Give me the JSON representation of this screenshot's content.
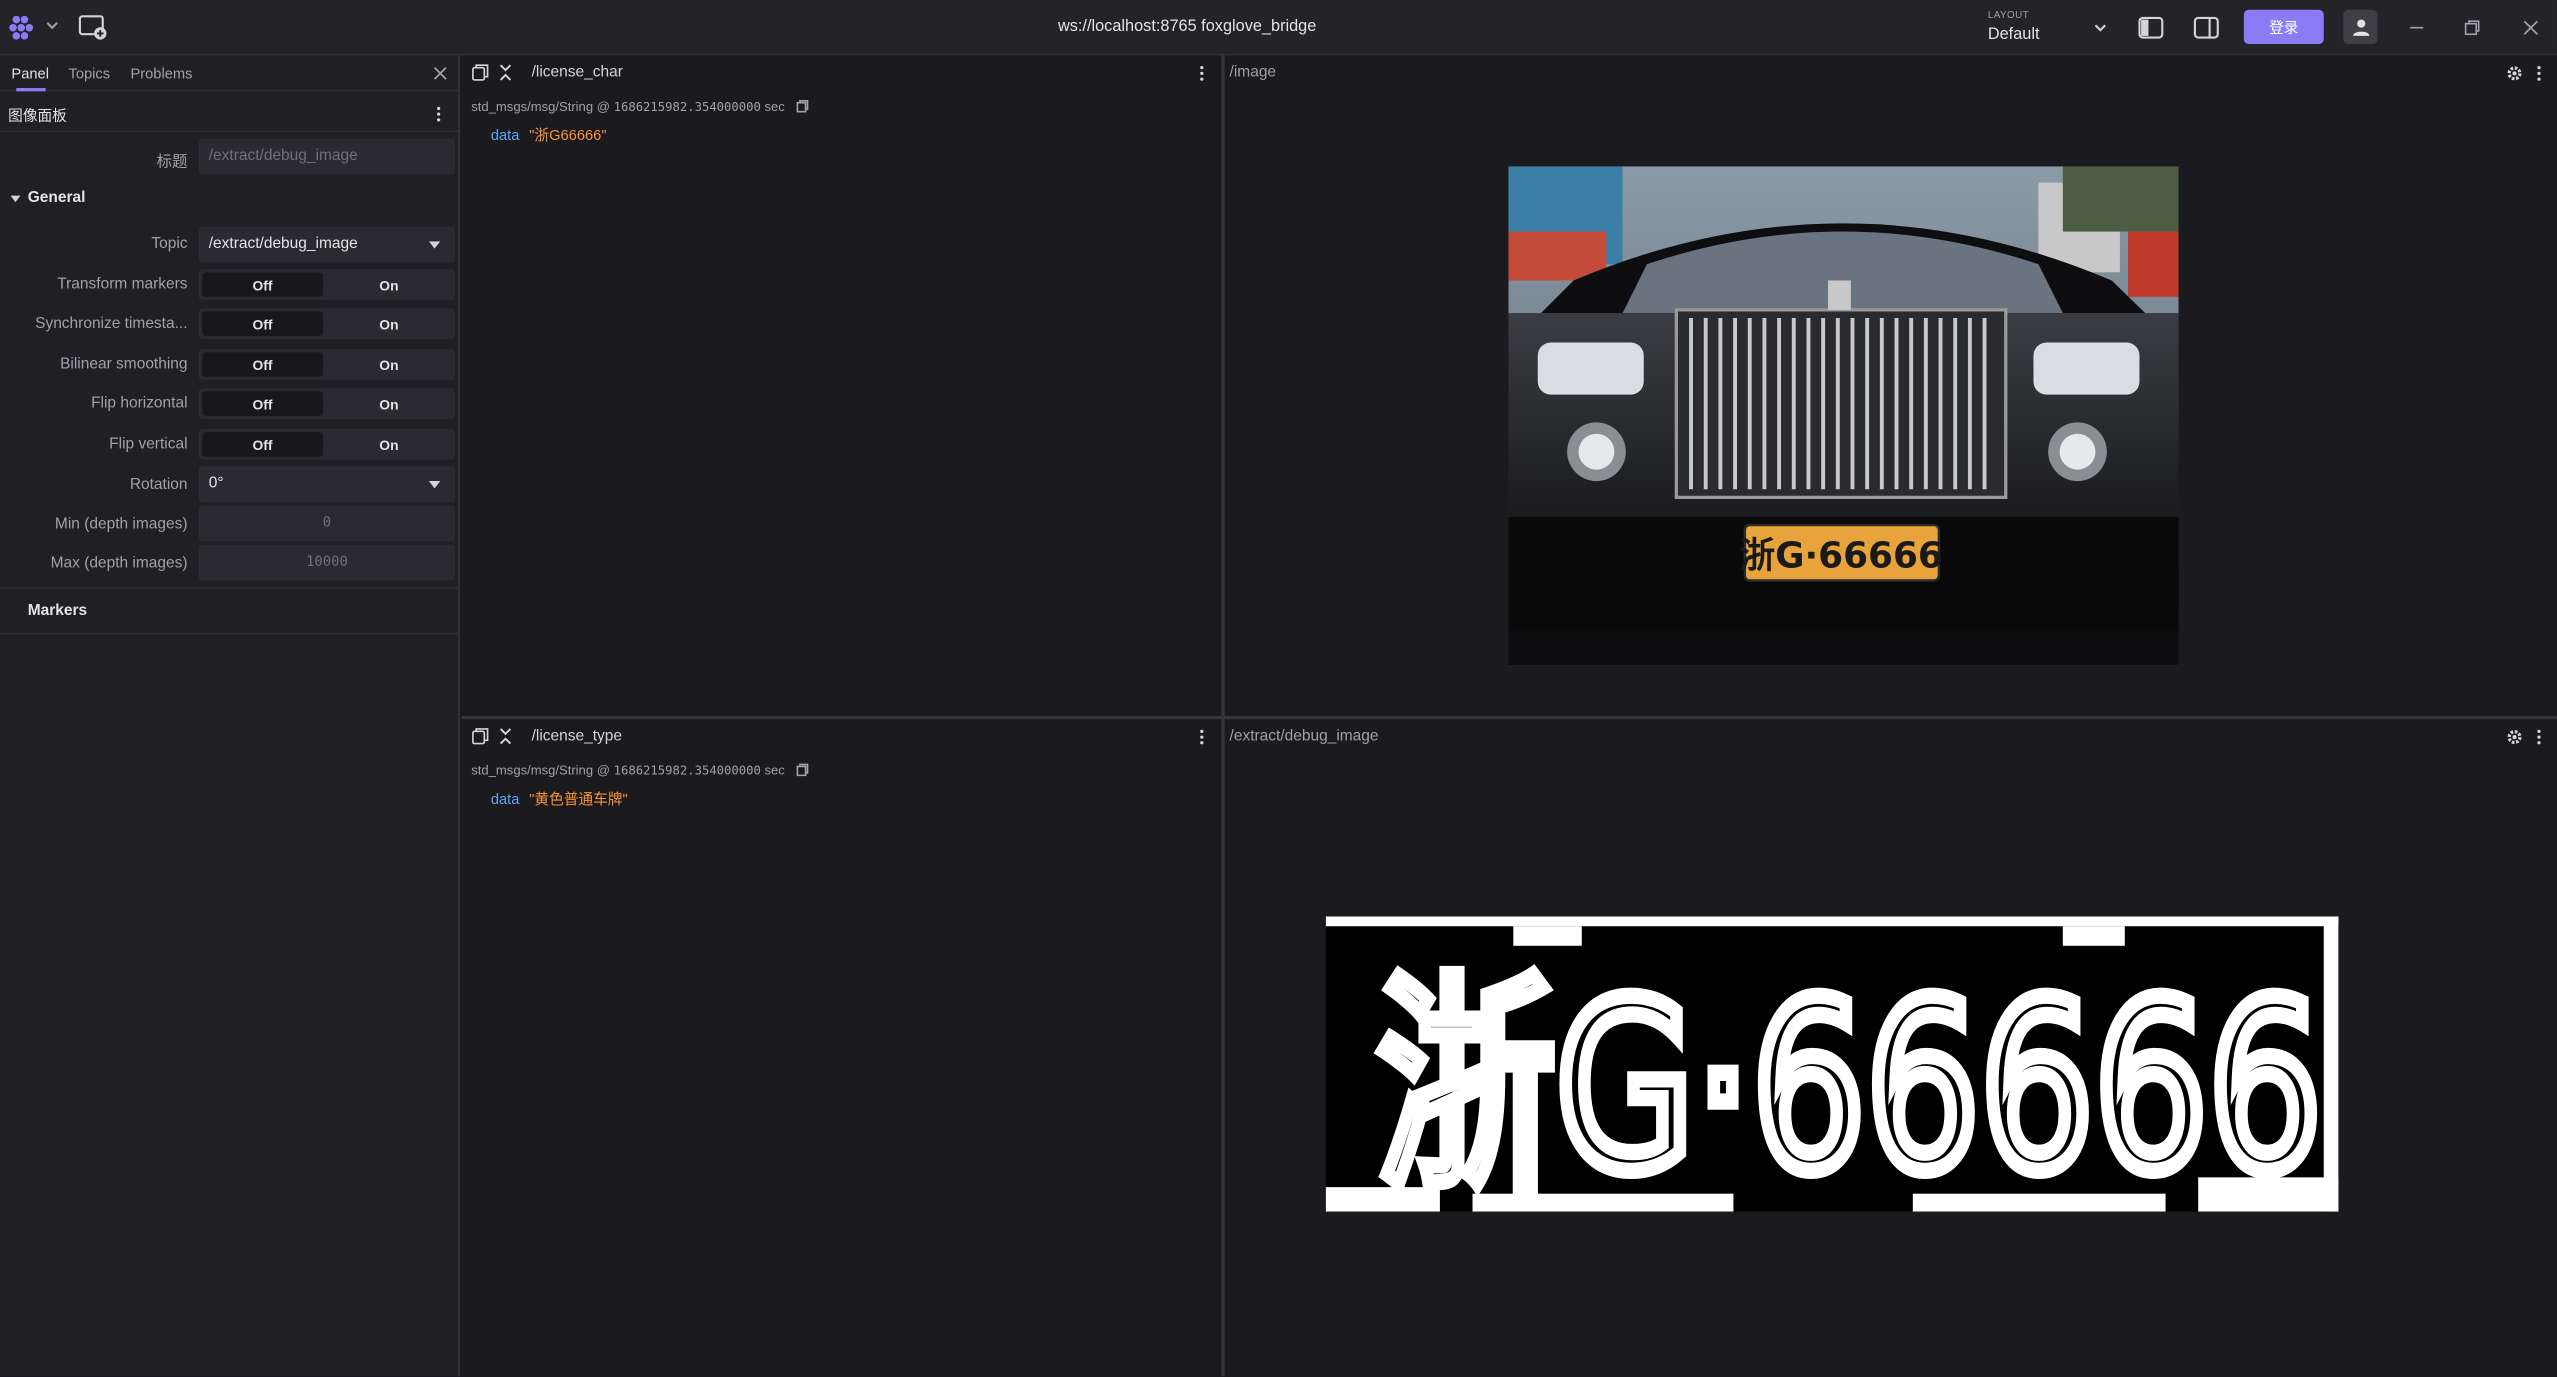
{
  "topbar": {
    "connection": "ws://localhost:8765 foxglove_bridge",
    "layout_label": "LAYOUT",
    "layout_name": "Default",
    "login_label": "登录"
  },
  "sidebar": {
    "tabs": [
      {
        "label": "Panel"
      },
      {
        "label": "Topics"
      },
      {
        "label": "Problems"
      }
    ],
    "panel_title": "图像面板",
    "title_field": {
      "label": "标题",
      "placeholder": "/extract/debug_image"
    },
    "general_label": "General",
    "topic": {
      "label": "Topic",
      "value": "/extract/debug_image"
    },
    "toggles": [
      {
        "label": "Transform markers",
        "off": "Off",
        "on": "On"
      },
      {
        "label": "Synchronize timesta...",
        "off": "Off",
        "on": "On"
      },
      {
        "label": "Bilinear smoothing",
        "off": "Off",
        "on": "On"
      },
      {
        "label": "Flip horizontal",
        "off": "Off",
        "on": "On"
      },
      {
        "label": "Flip vertical",
        "off": "Off",
        "on": "On"
      }
    ],
    "rotation": {
      "label": "Rotation",
      "value": "0°"
    },
    "min_depth": {
      "label": "Min (depth images)",
      "value": "0"
    },
    "max_depth": {
      "label": "Max (depth images)",
      "value": "10000"
    },
    "markers_label": "Markers"
  },
  "panels": {
    "license_char": {
      "title": "/license_char",
      "meta_type": "std_msgs/msg/String @",
      "meta_time": "1686215982.354000000",
      "meta_unit": "sec",
      "key": "data",
      "value": "\"浙G66666\""
    },
    "license_type": {
      "title": "/license_type",
      "meta_type": "std_msgs/msg/String @",
      "meta_time": "1686215982.354000000",
      "meta_unit": "sec",
      "key": "data",
      "value": "\"黄色普通车牌\""
    },
    "image": {
      "title": "/image",
      "plate_text": "浙G·66666"
    },
    "debug_image": {
      "title": "/extract/debug_image",
      "plate_text": "浙G·66666"
    }
  },
  "colors": {
    "accent": "#8b7cf6",
    "data_key": "#60a5fa",
    "data_value": "#fb923c",
    "plate_yellow": "#e8a33c"
  }
}
